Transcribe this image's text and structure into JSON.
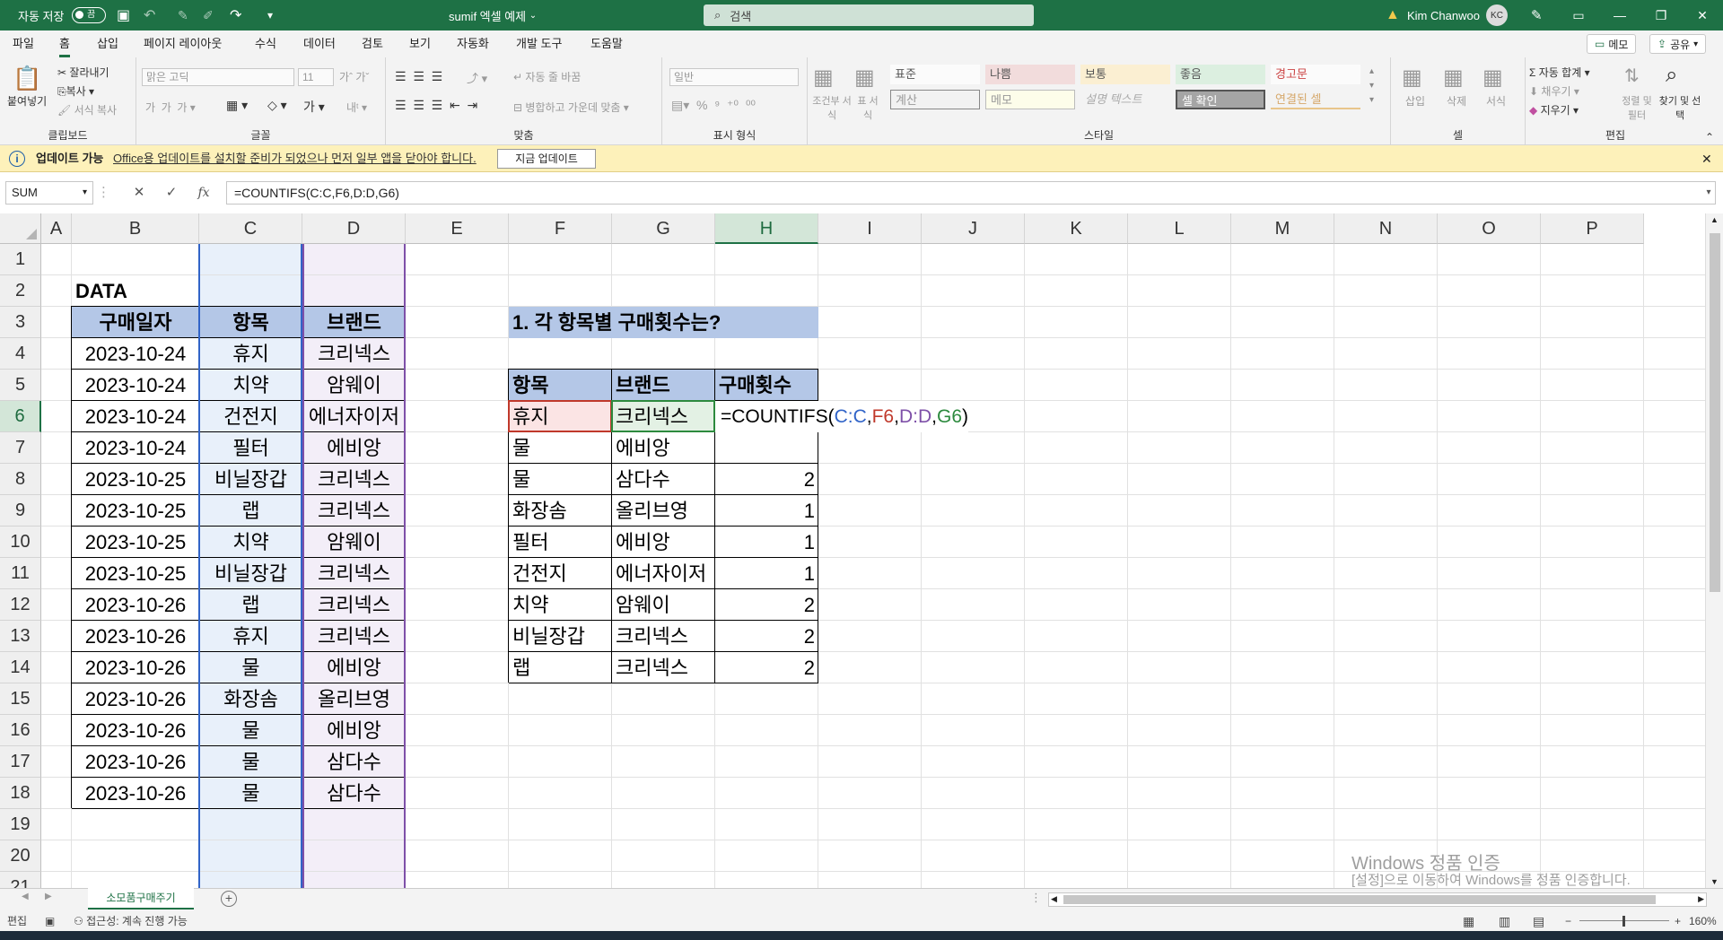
{
  "titlebar": {
    "autosave_label": "자동 저장",
    "autosave_state": "끔",
    "doc_title": "sumif 엑셀 예제",
    "search_placeholder": "검색",
    "user_name": "Kim Chanwoo",
    "user_initials": "KC"
  },
  "menu": {
    "tabs": [
      "파일",
      "홈",
      "삽입",
      "페이지 레이아웃",
      "수식",
      "데이터",
      "검토",
      "보기",
      "자동화",
      "개발 도구",
      "도움말"
    ],
    "memo_label": "메모",
    "share_label": "공유"
  },
  "ribbon": {
    "clipboard": {
      "paste": "붙여넣기",
      "cut": "잘라내기",
      "copy": "복사",
      "format_painter": "서식 복사",
      "label": "클립보드"
    },
    "font": {
      "font_name": "맑은 고딕",
      "font_size": "11",
      "label": "글꼴"
    },
    "alignment": {
      "wrap": "자동 줄 바꿈",
      "merge": "병합하고 가운데 맞춤",
      "label": "맞춤"
    },
    "number": {
      "format": "일반",
      "label": "표시 형식"
    },
    "styles": {
      "conditional": "조건부 서식",
      "table": "표 서식",
      "cells": [
        "표준",
        "나쁨",
        "보통",
        "좋음",
        "경고문",
        "계산",
        "메모",
        "설명 텍스트",
        "셀 확인",
        "연결된 셀"
      ],
      "label": "스타일"
    },
    "cells": {
      "insert": "삽입",
      "delete": "삭제",
      "format": "서식",
      "label": "셀"
    },
    "editing": {
      "autosum": "자동 합계",
      "fill": "채우기",
      "clear": "지우기",
      "sort": "정렬 및 필터",
      "find": "찾기 및 선택",
      "label": "편집"
    }
  },
  "update_bar": {
    "title": "업데이트 가능",
    "message": "Office용 업데이트를 설치할 준비가 되었으나 먼저 일부 앱을 닫아야 합니다.",
    "button": "지금 업데이트"
  },
  "formula_bar": {
    "name_box": "SUM",
    "formula": "=COUNTIFS(C:C,F6,D:D,G6)"
  },
  "columns": [
    "A",
    "B",
    "C",
    "D",
    "E",
    "F",
    "G",
    "H",
    "I",
    "J",
    "K",
    "L",
    "M",
    "N",
    "O",
    "P"
  ],
  "rows": [
    "1",
    "2",
    "3",
    "4",
    "5",
    "6",
    "7",
    "8",
    "9",
    "10",
    "11",
    "12",
    "13",
    "14",
    "15",
    "16",
    "17",
    "18",
    "19",
    "20",
    "21"
  ],
  "sheet": {
    "data_title": "DATA",
    "data_headers": [
      "구매일자",
      "항목",
      "브랜드"
    ],
    "data_rows": [
      [
        "2023-10-24",
        "휴지",
        "크리넥스"
      ],
      [
        "2023-10-24",
        "치약",
        "암웨이"
      ],
      [
        "2023-10-24",
        "건전지",
        "에너자이저"
      ],
      [
        "2023-10-24",
        "필터",
        "에비앙"
      ],
      [
        "2023-10-25",
        "비닐장갑",
        "크리넥스"
      ],
      [
        "2023-10-25",
        "랩",
        "크리넥스"
      ],
      [
        "2023-10-25",
        "치약",
        "암웨이"
      ],
      [
        "2023-10-25",
        "비닐장갑",
        "크리넥스"
      ],
      [
        "2023-10-26",
        "랩",
        "크리넥스"
      ],
      [
        "2023-10-26",
        "휴지",
        "크리넥스"
      ],
      [
        "2023-10-26",
        "물",
        "에비앙"
      ],
      [
        "2023-10-26",
        "화장솜",
        "올리브영"
      ],
      [
        "2023-10-26",
        "물",
        "에비앙"
      ],
      [
        "2023-10-26",
        "물",
        "삼다수"
      ],
      [
        "2023-10-26",
        "물",
        "삼다수"
      ]
    ],
    "question": "1. 각 항목별 구매횟수는?",
    "summary_headers": [
      "항목",
      "브랜드",
      "구매횟수"
    ],
    "summary_rows": [
      [
        "휴지",
        "크리넥스",
        ""
      ],
      [
        "물",
        "에비앙",
        ""
      ],
      [
        "물",
        "삼다수",
        "2"
      ],
      [
        "화장솜",
        "올리브영",
        "1"
      ],
      [
        "필터",
        "에비앙",
        "1"
      ],
      [
        "건전지",
        "에너자이저",
        "1"
      ],
      [
        "치약",
        "암웨이",
        "2"
      ],
      [
        "비닐장갑",
        "크리넥스",
        "2"
      ],
      [
        "랩",
        "크리넥스",
        "2"
      ]
    ],
    "edit_formula": {
      "prefix": "=COUNTIFS(",
      "arg1": "C:C",
      "sep1": ",",
      "arg2": "F6",
      "sep2": ",",
      "arg3": "D:D",
      "sep3": ",",
      "arg4": "G6",
      "suffix": ")"
    }
  },
  "sheet_tabs": [
    "소모품구매주기"
  ],
  "status": {
    "mode": "편집",
    "accessibility": "접근성: 계속 진행 가능",
    "zoom": "160%"
  },
  "watermark": {
    "line1": "Windows 정품 인증",
    "line2": "[설정]으로 이동하여 Windows를 정품 인증합니다."
  },
  "colors": {
    "excel_green": "#1e7145",
    "header_fill": "#b4c7e7",
    "ref_blue": "#3164c8",
    "ref_red": "#c0392b",
    "ref_purple": "#7e50a8",
    "ref_green": "#2d8a3e"
  }
}
